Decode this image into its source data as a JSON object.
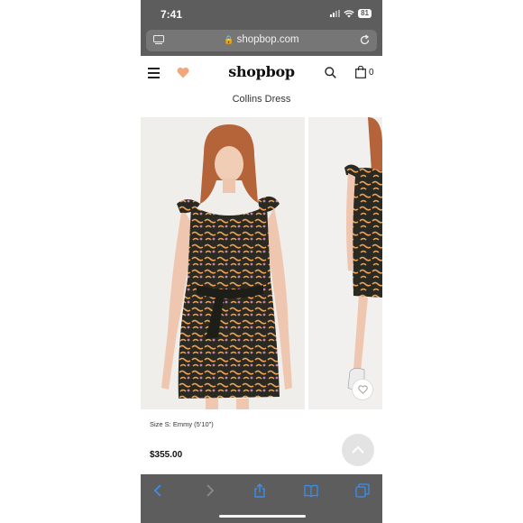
{
  "status_bar": {
    "time": "7:41",
    "battery": "81"
  },
  "browser": {
    "url": "shopbop.com",
    "lock_glyph": "🔒"
  },
  "site": {
    "logo": "shopbop",
    "bag_count": "0",
    "heart_color": "#f0a87a"
  },
  "product": {
    "title": "Collins Dress",
    "size_info": "Size S: Emmy (5'10\")",
    "price": "$355.00"
  },
  "icons": {
    "tabs": "tabs-icon",
    "reload": "reload-icon",
    "menu": "hamburger-menu-icon",
    "wishlist": "heart-icon",
    "search": "search-icon",
    "bag": "shopping-bag-icon",
    "back": "back-arrow-icon",
    "forward": "forward-arrow-icon",
    "share": "share-icon",
    "bookmarks": "bookmarks-icon",
    "tab_switcher": "tab-switcher-icon",
    "scroll_top": "chevron-up-icon"
  },
  "colors": {
    "chrome_bg": "#5d5d5d",
    "toolbar_icon": "#3b8ef0",
    "dress_base": "#2a2a22",
    "dress_pattern": "#e8a25c"
  }
}
